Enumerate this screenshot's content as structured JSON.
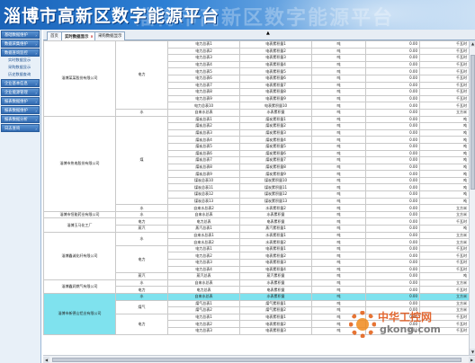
{
  "app": {
    "title": "淄博市高新区数字能源平台"
  },
  "sidebar": {
    "items": [
      {
        "label": "基础数据维护",
        "type": "group"
      },
      {
        "label": "数据采集维护",
        "type": "group"
      },
      {
        "label": "数据查询监控",
        "type": "group"
      },
      {
        "label": "实时数据显示",
        "type": "sub"
      },
      {
        "label": "采购数据显示",
        "type": "sub"
      },
      {
        "label": "历史数据查询",
        "type": "sub"
      },
      {
        "label": "企业基本信息",
        "type": "group"
      },
      {
        "label": "企业能源管理",
        "type": "group"
      },
      {
        "label": "报表数据维护",
        "type": "group"
      },
      {
        "label": "报表数据维护",
        "type": "group"
      },
      {
        "label": "报表数据分析",
        "type": "group"
      },
      {
        "label": "日志查询",
        "type": "group"
      }
    ]
  },
  "tabs": [
    {
      "label": "首页",
      "active": false
    },
    {
      "label": "实时数据显示",
      "active": true,
      "close": "×"
    },
    {
      "label": "采购数据显示",
      "active": false
    }
  ],
  "scroll": {
    "up": "▲",
    "down": "▼",
    "left": "◀",
    "right": "▶"
  },
  "marker": "▲",
  "grid": {
    "rows": [
      {
        "company": "淄博某某股份有限公司",
        "cspan": 11,
        "energy": "电力",
        "espan": 10,
        "meter": "电力总表1",
        "item": "电表累积量1",
        "unit_a": "吨",
        "value": "0.00",
        "unit": "千瓦时"
      },
      {
        "meter": "电力总表2",
        "item": "电表累积量2",
        "unit_a": "吨",
        "value": "0.00",
        "unit": "千瓦时"
      },
      {
        "meter": "电力总表3",
        "item": "电表累积量3",
        "unit_a": "吨",
        "value": "0.00",
        "unit": "千瓦时"
      },
      {
        "meter": "电力总表4",
        "item": "电表累积量4",
        "unit_a": "吨",
        "value": "0.00",
        "unit": "千瓦时"
      },
      {
        "meter": "电力总表5",
        "item": "电表累积量5",
        "unit_a": "吨",
        "value": "0.00",
        "unit": "千瓦时"
      },
      {
        "meter": "电力总表6",
        "item": "电表累积量6",
        "unit_a": "吨",
        "value": "0.00",
        "unit": "千瓦时"
      },
      {
        "meter": "电力总表7",
        "item": "电表累积量7",
        "unit_a": "吨",
        "value": "0.00",
        "unit": "千瓦时"
      },
      {
        "meter": "电力总表8",
        "item": "电表累积量8",
        "unit_a": "吨",
        "value": "0.00",
        "unit": "千瓦时"
      },
      {
        "meter": "电力总表9",
        "item": "电表累积量9",
        "unit_a": "吨",
        "value": "0.00",
        "unit": "千瓦时"
      },
      {
        "meter": "电力总表10",
        "item": "电表累积量10",
        "unit_a": "吨",
        "value": "0.00",
        "unit": "千瓦时"
      },
      {
        "energy": "水",
        "espan": 1,
        "meter": "自来水总表",
        "item": "水表累积量",
        "unit_a": "吨",
        "value": "0.00",
        "unit": "立方米"
      },
      {
        "company": "淄博市热电股份有限公司",
        "cspan": 14,
        "energy": "煤",
        "espan": 13,
        "meter": "煤炭总表1",
        "item": "煤炭累积量1",
        "unit_a": "吨",
        "value": "0.00",
        "unit": "吨"
      },
      {
        "meter": "煤炭总表2",
        "item": "煤炭累积量2",
        "unit_a": "吨",
        "value": "0.00",
        "unit": "吨"
      },
      {
        "meter": "煤炭总表3",
        "item": "煤炭累积量3",
        "unit_a": "吨",
        "value": "0.00",
        "unit": "吨"
      },
      {
        "meter": "煤炭总表4",
        "item": "煤炭累积量4",
        "unit_a": "吨",
        "value": "0.00",
        "unit": "吨"
      },
      {
        "meter": "煤炭总表5",
        "item": "煤炭累积量5",
        "unit_a": "吨",
        "value": "0.00",
        "unit": "吨"
      },
      {
        "meter": "煤炭总表6",
        "item": "煤炭累积量6",
        "unit_a": "吨",
        "value": "0.00",
        "unit": "吨"
      },
      {
        "meter": "煤炭总表7",
        "item": "煤炭累积量7",
        "unit_a": "吨",
        "value": "0.00",
        "unit": "吨"
      },
      {
        "meter": "煤炭总表8",
        "item": "煤炭累积量8",
        "unit_a": "吨",
        "value": "0.00",
        "unit": "吨"
      },
      {
        "meter": "煤炭总表9",
        "item": "煤炭累积量9",
        "unit_a": "吨",
        "value": "0.00",
        "unit": "吨"
      },
      {
        "meter": "煤炭总表10",
        "item": "煤炭累积量10",
        "unit_a": "吨",
        "value": "0.00",
        "unit": "吨"
      },
      {
        "meter": "煤炭总表11",
        "item": "煤炭累积量11",
        "unit_a": "吨",
        "value": "0.00",
        "unit": "吨"
      },
      {
        "meter": "煤炭总表12",
        "item": "煤炭累积量12",
        "unit_a": "吨",
        "value": "0.00",
        "unit": "吨"
      },
      {
        "meter": "煤炭总表13",
        "item": "煤炭累积量13",
        "unit_a": "吨",
        "value": "0.00",
        "unit": "吨"
      },
      {
        "energy": "水",
        "espan": 1,
        "meter": "自来水总表2",
        "item": "水表累积量2",
        "unit_a": "吨",
        "value": "0.00",
        "unit": "立方米"
      },
      {
        "company": "淄博市恒能药业有限公司",
        "cspan": 1,
        "energy": "水",
        "espan": 1,
        "meter": "自来水总表",
        "item": "水表累积量",
        "unit_a": "吨",
        "value": "0.00",
        "unit": "立方米"
      },
      {
        "company": "淄博玉马化工厂",
        "cspan": 2,
        "energy": "电力",
        "espan": 1,
        "meter": "电力总表",
        "item": "电表累积量",
        "unit_a": "吨",
        "value": "0.00",
        "unit": "千瓦时"
      },
      {
        "energy": "蒸汽",
        "espan": 1,
        "meter": "蒸汽总表1",
        "item": "蒸汽累积量1",
        "unit_a": "吨",
        "value": "0.00",
        "unit": "吨"
      },
      {
        "company": "淄博鑫诚化纤有限公司",
        "cspan": 7,
        "energy": "水",
        "espan": 2,
        "meter": "自来水总表1",
        "item": "水表累积量1",
        "unit_a": "吨",
        "value": "0.00",
        "unit": "立方米"
      },
      {
        "meter": "自来水总表2",
        "item": "水表累积量2",
        "unit_a": "吨",
        "value": "0.00",
        "unit": "立方米"
      },
      {
        "energy": "电力",
        "espan": 4,
        "meter": "电力总表1",
        "item": "电表累积量1",
        "unit_a": "吨",
        "value": "0.00",
        "unit": "千瓦时"
      },
      {
        "meter": "电力总表2",
        "item": "电表累积量2",
        "unit_a": "吨",
        "value": "0.00",
        "unit": "千瓦时"
      },
      {
        "meter": "电力总表3",
        "item": "电表累积量3",
        "unit_a": "吨",
        "value": "0.00",
        "unit": "千瓦时"
      },
      {
        "meter": "电力总表4",
        "item": "电表累积量4",
        "unit_a": "吨",
        "value": "0.00",
        "unit": "千瓦时"
      },
      {
        "energy": "蒸汽",
        "espan": 1,
        "meter": "蒸汽总表",
        "item": "蒸汽累积量",
        "unit_a": "吨",
        "value": "0.00",
        "unit": "吨"
      },
      {
        "company": "淄博鑫润燃气有限公司",
        "cspan": 2,
        "energy": "水",
        "espan": 1,
        "meter": "自来水总表",
        "item": "水表累积量",
        "unit_a": "吨",
        "value": "0.00",
        "unit": "立方米"
      },
      {
        "energy": "电力",
        "espan": 1,
        "meter": "电力总表",
        "item": "电表累积量",
        "unit_a": "吨",
        "value": "0.00",
        "unit": "千瓦时"
      },
      {
        "hl": true,
        "company": "淄博市新德山铝业有限公司",
        "cspan": 6,
        "energy": "水",
        "espan": 1,
        "meter": "自来水总表",
        "item": "水表累积量",
        "unit_a": "吨",
        "value": "0.00",
        "unit": "立方米"
      },
      {
        "energy": "煤气",
        "espan": 2,
        "meter": "煤气总表1",
        "item": "煤气累积量1",
        "unit_a": "吨",
        "value": "0.00",
        "unit": "立方米"
      },
      {
        "meter": "煤气总表2",
        "item": "煤气累积量2",
        "unit_a": "吨",
        "value": "0.00",
        "unit": "立方米"
      },
      {
        "energy": "电力",
        "espan": 3,
        "meter": "电力总表1",
        "item": "电表累积量1",
        "unit_a": "吨",
        "value": "0.00",
        "unit": "千瓦时"
      },
      {
        "meter": "电力总表2",
        "item": "电表累积量2",
        "unit_a": "吨",
        "value": "0.00",
        "unit": "千瓦时"
      },
      {
        "meter": "电力总表3",
        "item": "电表累积量3",
        "unit_a": "吨",
        "value": "0.00",
        "unit": "千瓦时"
      }
    ]
  },
  "watermark": {
    "cn": "中华工控网",
    "url": "gkong.com"
  }
}
